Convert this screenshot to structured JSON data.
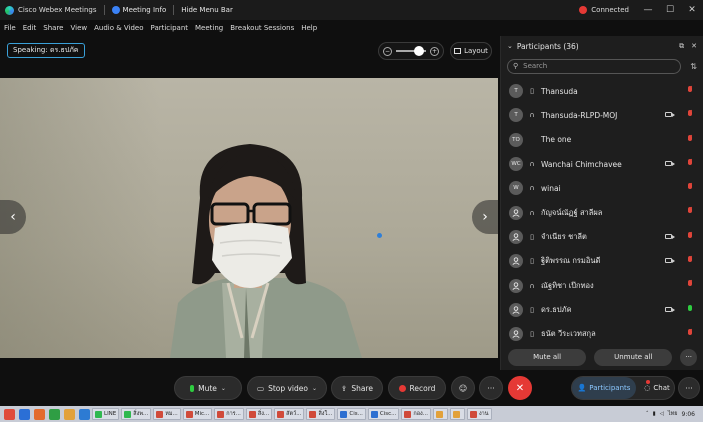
{
  "titlebar": {
    "app_title": "Cisco Webex Meetings",
    "meeting_info": "Meeting Info",
    "hide_menu": "Hide Menu Bar",
    "status": "Connected",
    "minimize": "—",
    "maximize": "☐",
    "close": "✕"
  },
  "menu": [
    "File",
    "Edit",
    "Share",
    "View",
    "Audio & Video",
    "Participant",
    "Meeting",
    "Breakout Sessions",
    "Help"
  ],
  "speaking": "Speaking: ดร.ธปภัค",
  "zoom": {
    "minus": "−",
    "plus": "+",
    "level": 0.78
  },
  "layout_label": "Layout",
  "video": {
    "prev": "‹",
    "next": "›"
  },
  "participants": {
    "title": "Participants (36)",
    "search_placeholder": "Search",
    "list": [
      {
        "initials": "T",
        "name": "Thansuda",
        "device": "phone",
        "camera": false,
        "mic": "muted"
      },
      {
        "initials": "T",
        "name": "Thansuda-RLPD-MOJ",
        "device": "headset",
        "camera": true,
        "mic": "muted"
      },
      {
        "initials": "TO",
        "name": "The one",
        "device": "none",
        "camera": false,
        "mic": "muted"
      },
      {
        "initials": "WC",
        "name": "Wanchai Chimchavee",
        "device": "headset",
        "camera": true,
        "mic": "muted"
      },
      {
        "initials": "W",
        "name": "winai",
        "device": "headset",
        "camera": false,
        "mic": "muted"
      },
      {
        "initials": "",
        "name": "กัญจน์ณัฏฐ์ สาลีผล",
        "device": "headset",
        "camera": false,
        "mic": "muted"
      },
      {
        "initials": "",
        "name": "จำเนียร ชาลีต",
        "device": "phone",
        "camera": true,
        "mic": "muted"
      },
      {
        "initials": "",
        "name": "ฐิติพรรณ กรมอินดี",
        "device": "phone",
        "camera": true,
        "mic": "muted"
      },
      {
        "initials": "",
        "name": "ณัฐทิชา เป๊กทอง",
        "device": "headset",
        "camera": false,
        "mic": "muted"
      },
      {
        "initials": "",
        "name": "ดร.ธปภัค",
        "device": "phone",
        "camera": true,
        "mic": "on"
      },
      {
        "initials": "",
        "name": "ธนัต วีระเวทสกุล",
        "device": "phone",
        "camera": false,
        "mic": "muted"
      }
    ],
    "mute_all": "Mute all",
    "unmute_all": "Unmute all",
    "more": "···"
  },
  "controls": {
    "mute": "Mute",
    "stop_video": "Stop video",
    "share": "Share",
    "record": "Record",
    "reactions": "☺",
    "more": "···",
    "end": "✕",
    "participants": "Participants",
    "chat": "Chat",
    "right_more": "···"
  },
  "taskbar": {
    "items": [
      "LINE",
      "สิ่งพ...",
      "หม...",
      "Mic...",
      "การ...",
      "สิ่ง...",
      "สัตว์...",
      "สิ่งใ...",
      "Cis...",
      "Cisc...",
      "กอง...",
      "",
      "",
      "งาน"
    ],
    "lang": "ไทย",
    "time": "9:06"
  },
  "colors": {
    "accent": "#3aa0d8",
    "end_call": "#e53935",
    "muted": "#e0453a",
    "active_mic": "#2ecc40"
  }
}
